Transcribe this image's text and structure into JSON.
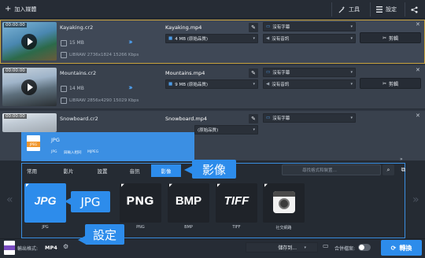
{
  "toolbar": {
    "add_media": "加入媒體",
    "tools": "工具",
    "settings": "設定"
  },
  "files": [
    {
      "time": "00:00:00",
      "name": "Kayaking.cr2",
      "size": "15 MB",
      "meta": "LIBRAW 2736x1824 15266 Kbps",
      "output_name": "Kayaking.mp4",
      "output_size": "4 MB (原始品質)",
      "subtitle": "沒有字幕",
      "audio": "沒有音訊",
      "cut": "剪輯"
    },
    {
      "time": "00:00:00",
      "name": "Mountains.cr2",
      "size": "14 MB",
      "meta": "LIBRAW 2856x4290 15029 Kbps",
      "output_name": "Mountains.mp4",
      "output_size": "9 MB (原始品質)",
      "subtitle": "沒有字幕",
      "audio": "沒有音訊",
      "cut": "剪輯"
    },
    {
      "time": "00:00:00",
      "name": "Snowboard.cr2",
      "size": "",
      "meta": "",
      "output_name": "Snowboard.mp4",
      "output_size": "(原始品質)",
      "subtitle": "沒有字幕",
      "audio": "",
      "cut": ""
    }
  ],
  "format_tip": {
    "badge": "JPEG",
    "title": "JPG",
    "specs": [
      "JPG",
      "與輸入相同",
      "MJPEG"
    ]
  },
  "tabs": [
    "常用",
    "影片",
    "音訊",
    "音訊",
    "影像"
  ],
  "tabs_fixed": [
    "常用",
    "影片",
    "設置",
    "音訊",
    "影像"
  ],
  "active_tab_callout": "影像",
  "search_placeholder": "尋找格式和裝置…",
  "formats": [
    {
      "icon": "JPG",
      "label": "JPG"
    },
    {
      "icon": "",
      "label": ""
    },
    {
      "icon": "PNG",
      "label": "PNG"
    },
    {
      "icon": "BMP",
      "label": "BMP"
    },
    {
      "icon": "TIFF",
      "label": "TIFF"
    },
    {
      "icon": "",
      "label": "社交網路"
    }
  ],
  "jpg_callout": "JPG",
  "settings_callout": "設定",
  "bottom": {
    "output_label": "輸出格式:",
    "output_value": "MP4",
    "save_to": "儲存到...",
    "merge": "合併檔案:",
    "convert": "轉換"
  }
}
